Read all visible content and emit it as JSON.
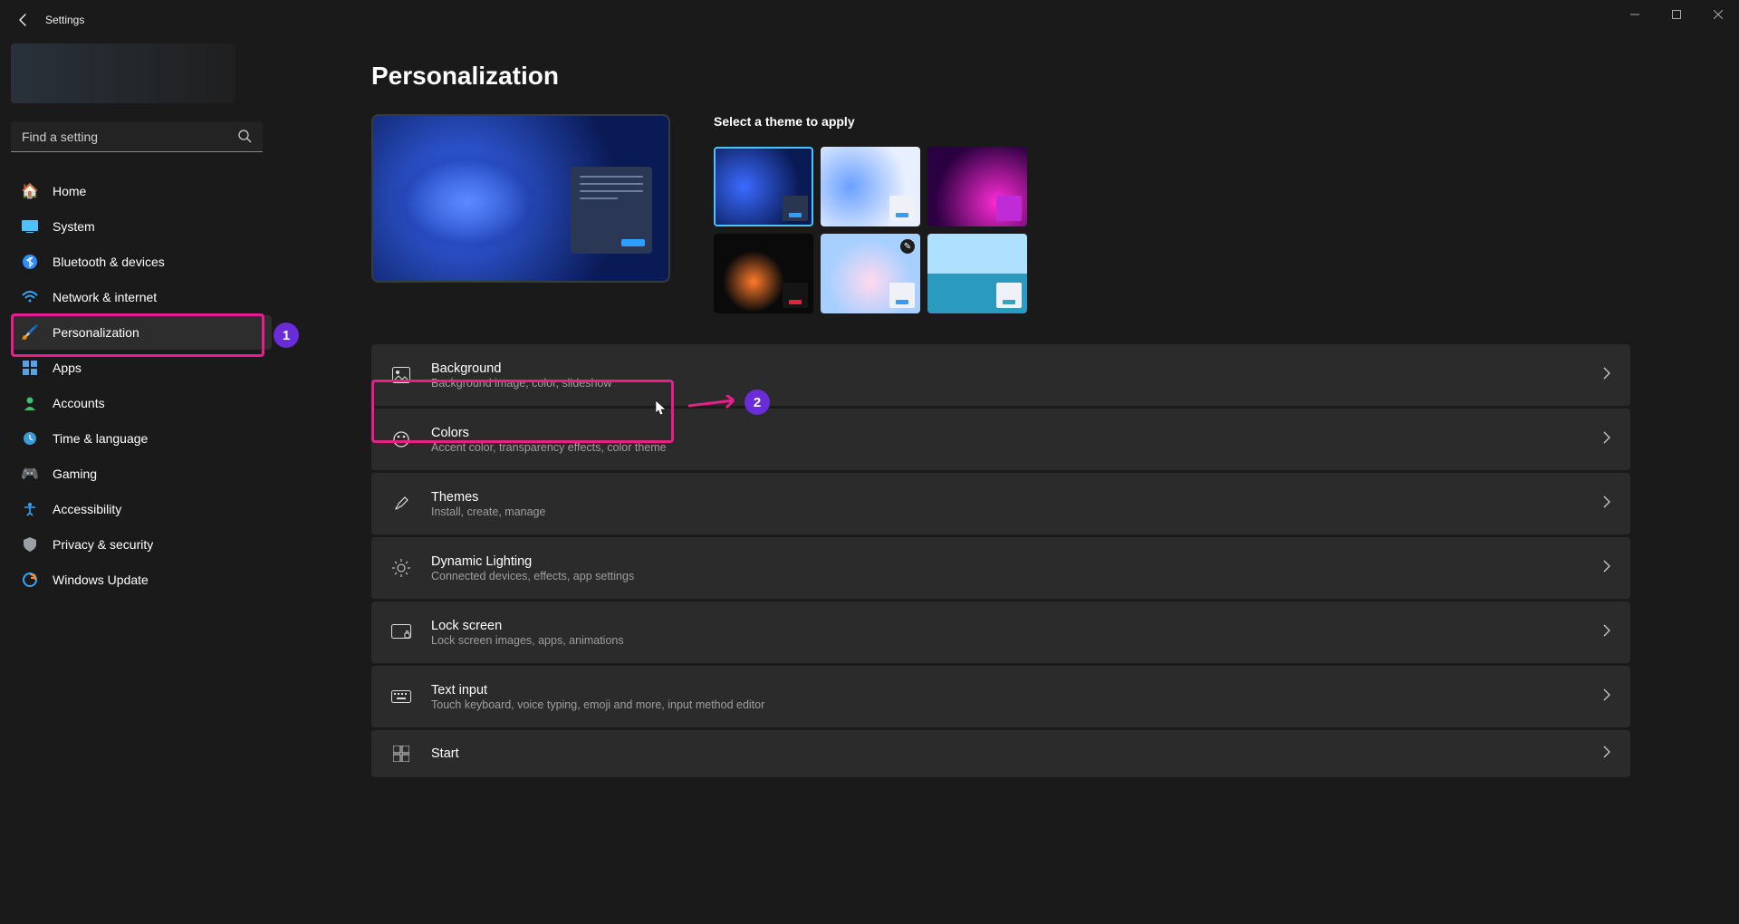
{
  "titlebar": {
    "app": "Settings"
  },
  "search": {
    "placeholder": "Find a setting"
  },
  "nav": {
    "items": [
      {
        "label": "Home",
        "icon": "🏠"
      },
      {
        "label": "System",
        "icon": "🖥️"
      },
      {
        "label": "Bluetooth & devices",
        "icon": "ble"
      },
      {
        "label": "Network & internet",
        "icon": "wifi"
      },
      {
        "label": "Personalization",
        "icon": "🖌️"
      },
      {
        "label": "Apps",
        "icon": "▦"
      },
      {
        "label": "Accounts",
        "icon": "👤"
      },
      {
        "label": "Time & language",
        "icon": "🕒"
      },
      {
        "label": "Gaming",
        "icon": "🎮"
      },
      {
        "label": "Accessibility",
        "icon": "acc"
      },
      {
        "label": "Privacy & security",
        "icon": "🛡️"
      },
      {
        "label": "Windows Update",
        "icon": "↻"
      }
    ],
    "active_index": 4
  },
  "page": {
    "title": "Personalization",
    "theme_heading": "Select a theme to apply"
  },
  "rows": [
    {
      "title": "Background",
      "desc": "Background image, color, slideshow"
    },
    {
      "title": "Colors",
      "desc": "Accent color, transparency effects, color theme"
    },
    {
      "title": "Themes",
      "desc": "Install, create, manage"
    },
    {
      "title": "Dynamic Lighting",
      "desc": "Connected devices, effects, app settings"
    },
    {
      "title": "Lock screen",
      "desc": "Lock screen images, apps, animations"
    },
    {
      "title": "Text input",
      "desc": "Touch keyboard, voice typing, emoji and more, input method editor"
    },
    {
      "title": "Start",
      "desc": ""
    }
  ],
  "annotations": {
    "badge1": "1",
    "badge2": "2"
  }
}
